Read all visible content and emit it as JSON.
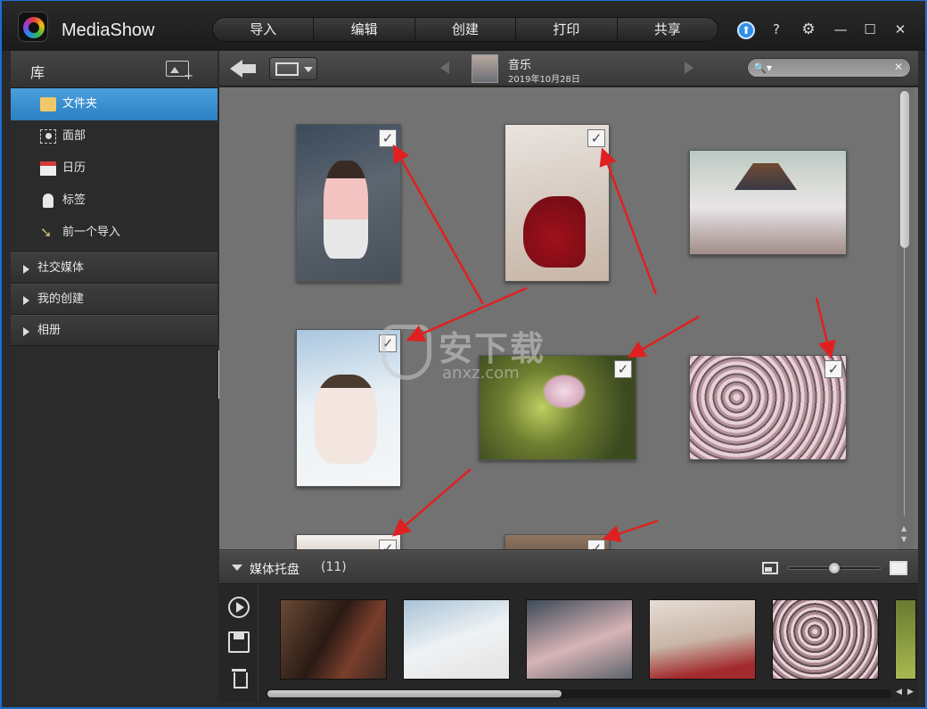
{
  "app": {
    "title": "MediaShow"
  },
  "menu": {
    "items": [
      "导入",
      "编辑",
      "创建",
      "打印",
      "共享"
    ]
  },
  "window_controls": {
    "help": "?",
    "settings": "⚙",
    "minimize": "—",
    "maximize": "☐",
    "close": "✕",
    "update": "⬆"
  },
  "sidebar": {
    "title": "库",
    "items": [
      {
        "label": "文件夹",
        "icon": "folder-icon",
        "active": true
      },
      {
        "label": "面部",
        "icon": "face-icon"
      },
      {
        "label": "日历",
        "icon": "calendar-icon"
      },
      {
        "label": "标签",
        "icon": "tag-icon"
      },
      {
        "label": "前一个导入",
        "icon": "import-icon"
      }
    ],
    "groups": [
      "社交媒体",
      "我的创建",
      "相册"
    ]
  },
  "toolbar": {
    "album_name": "音乐",
    "album_date": "2019年10月28日",
    "search_placeholder": "",
    "search_clear": "✕"
  },
  "photos": [
    {
      "name": "girl-pink-sweater",
      "checked": true
    },
    {
      "name": "woman-red-dress",
      "checked": true
    },
    {
      "name": "temple-cherry-blossom",
      "checked": false
    },
    {
      "name": "woman-white-dress",
      "checked": true
    },
    {
      "name": "wind-chime-blossom",
      "checked": true
    },
    {
      "name": "cherry-blossom-branches",
      "checked": true
    },
    {
      "name": "photo-partial-1",
      "checked": true
    },
    {
      "name": "photo-partial-2",
      "checked": true
    }
  ],
  "watermark": {
    "text": "安下载",
    "sub": "anxz.com"
  },
  "tray": {
    "title": "媒体托盘",
    "count": "(11)",
    "size_slider_level": 0.5
  },
  "colors": {
    "accent": "#2c7fc2",
    "arrow": "#e02020",
    "frame": "#1d6fd0"
  }
}
